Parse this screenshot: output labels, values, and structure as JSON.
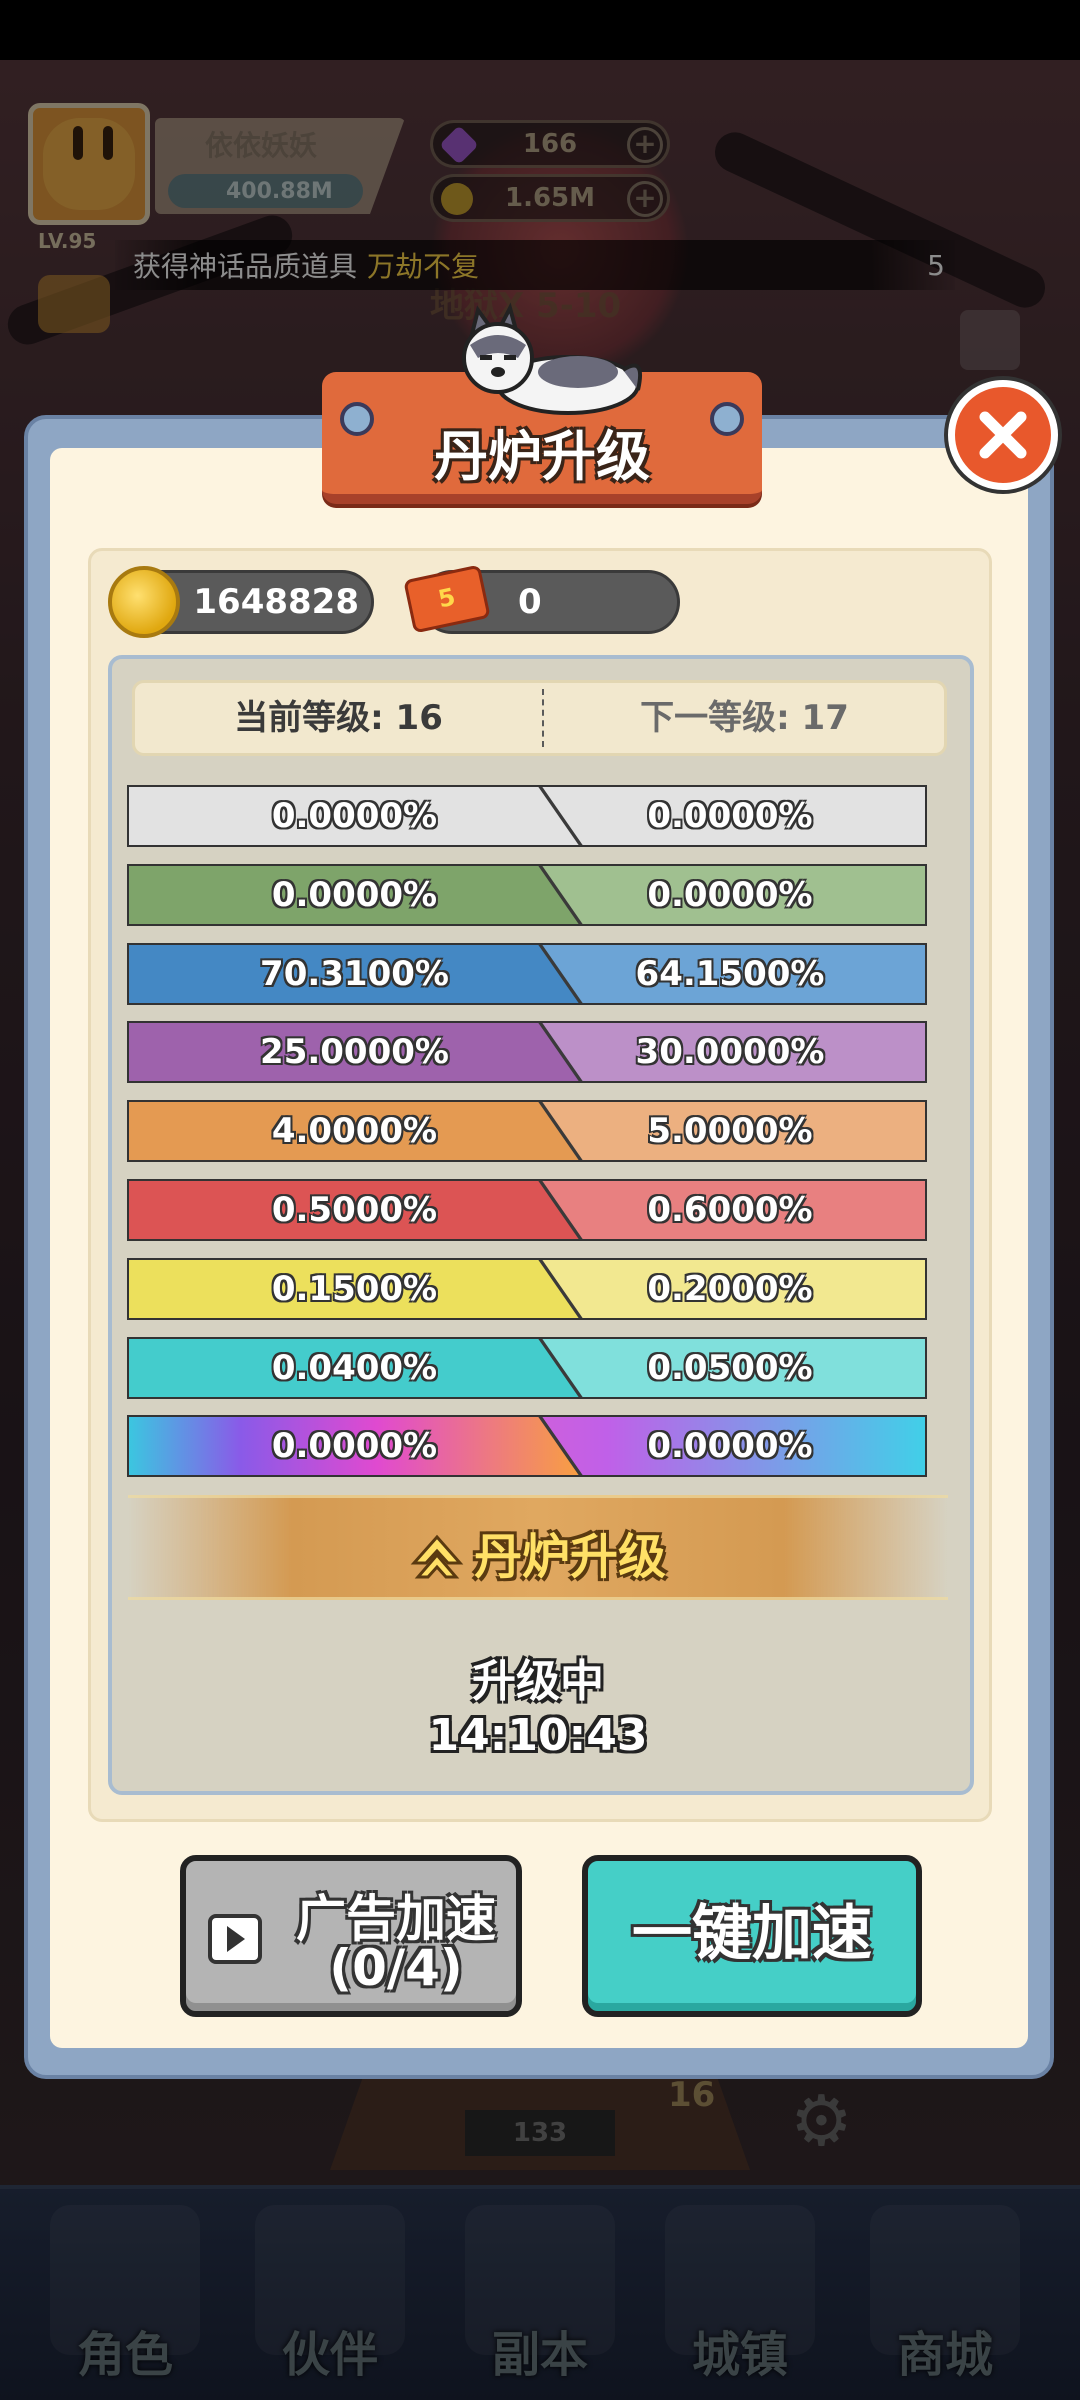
{
  "player": {
    "level": "LV.95",
    "name": "依依妖妖",
    "power": "400.88M"
  },
  "resources": {
    "gems": "166",
    "coins": "1.65M"
  },
  "notice": {
    "prefix": "获得神话品质道具",
    "item": "万劫不复",
    "tail": "5"
  },
  "stage": "地狱X 5-10",
  "dialog": {
    "title": "丹炉升级",
    "coin_balance": "1648828",
    "ticket_badge": "5",
    "ticket_count": "0",
    "current_level_label": "当前等级: 16",
    "next_level_label": "下一等级: 17",
    "rows": [
      {
        "current": "0.0000%",
        "next": "0.0000%",
        "color_left": "#e2e2e2",
        "color_right": "#e2e2e2"
      },
      {
        "current": "0.0000%",
        "next": "0.0000%",
        "color_left": "#7ea46a",
        "color_right": "#a0c090"
      },
      {
        "current": "70.3100%",
        "next": "64.1500%",
        "color_left": "#4488c4",
        "color_right": "#6ca4d6"
      },
      {
        "current": "25.0000%",
        "next": "30.0000%",
        "color_left": "#9e62ac",
        "color_right": "#bc90c8"
      },
      {
        "current": "4.0000%",
        "next": "5.0000%",
        "color_left": "#e49a52",
        "color_right": "#ecb080"
      },
      {
        "current": "0.5000%",
        "next": "0.6000%",
        "color_left": "#dc5454",
        "color_right": "#e88080"
      },
      {
        "current": "0.1500%",
        "next": "0.2000%",
        "color_left": "#ece05c",
        "color_right": "#f2e890"
      },
      {
        "current": "0.0400%",
        "next": "0.0500%",
        "color_left": "#44cccc",
        "color_right": "#80e0dc"
      },
      {
        "current": "0.0000%",
        "next": "0.0000%",
        "color_left": "rainbow",
        "color_right": "rainbow"
      }
    ],
    "upgrade_label": "丹炉升级",
    "status_label": "升级中",
    "timer": "14:10:43",
    "ad_button_line1": "广告加速",
    "ad_button_line2": "(0/4)",
    "speed_button": "一键加速"
  },
  "background": {
    "stat_133": "133",
    "badge_16": "16"
  },
  "nav": {
    "items": [
      {
        "label": "角色",
        "icon": "character-icon"
      },
      {
        "label": "伙伴",
        "icon": "partner-icon"
      },
      {
        "label": "副本",
        "icon": "dungeon-icon"
      },
      {
        "label": "城镇",
        "icon": "town-icon"
      },
      {
        "label": "商城",
        "icon": "shop-icon"
      }
    ]
  }
}
